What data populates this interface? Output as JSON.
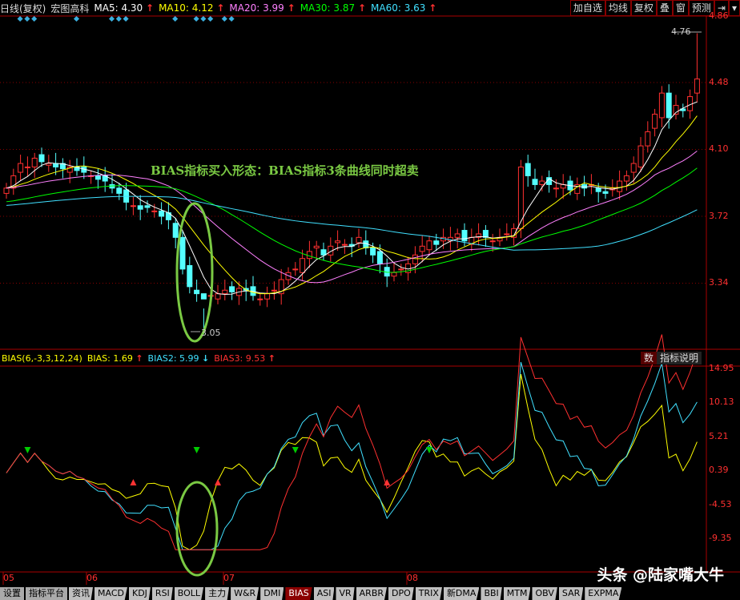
{
  "header": {
    "period": "日线(复权)",
    "stock": "宏图高科",
    "ma": [
      {
        "label": "MA5: 4.30",
        "color": "#ffffff"
      },
      {
        "label": "MA10: 4.12",
        "color": "#ffff00"
      },
      {
        "label": "MA20: 3.99",
        "color": "#ff80ff"
      },
      {
        "label": "MA30: 3.87",
        "color": "#00ff00"
      },
      {
        "label": "MA60: 3.63",
        "color": "#40e0ff"
      }
    ],
    "arrow_up": "↑",
    "arrow_down": "↓",
    "buttons": [
      "加自选",
      "均线",
      "复权",
      "叠",
      "窗",
      "预测",
      "⇥",
      "▾"
    ]
  },
  "price_axis": [
    "4.86",
    "4.48",
    "4.10",
    "3.72",
    "3.34"
  ],
  "price_marks": {
    "high": "4.76",
    "low": "3.05"
  },
  "annotation": "BIAS指标买入形态：BIAS指标3条曲线同时超卖",
  "indicator": {
    "title": "BIAS(6,-3,3,12,24)",
    "bias1": "BIAS: 1.69",
    "bias2": "BIAS2: 5.99",
    "bias3": "BIAS3: 9.53",
    "buttons": [
      "数",
      "指标说明"
    ],
    "axis": [
      "14.95",
      "10.13",
      "5.21",
      "0.39",
      "-4.53",
      "-9.35"
    ]
  },
  "dates": [
    "05",
    "06",
    "07",
    "08"
  ],
  "watermark": "头条 @陆家嘴大牛",
  "tabs": [
    "设置",
    "指标平台",
    "资讯",
    "MACD",
    "KDJ",
    "RSI",
    "BOLL",
    "主力",
    "W&R",
    "DMI",
    "BIAS",
    "ASI",
    "VR",
    "ARBR",
    "DPO",
    "TRIX",
    "新DMA",
    "BBI",
    "MTM",
    "OBV",
    "SAR",
    "EXPMA"
  ],
  "active_tab": "BIAS",
  "chart_data": {
    "type": "candlestick",
    "ylim": [
      3.0,
      4.86
    ],
    "bias_ylim": [
      -12,
      17
    ],
    "closes": [
      3.88,
      3.95,
      4.02,
      4.0,
      4.05,
      4.03,
      4.02,
      4.0,
      3.99,
      4.0,
      3.98,
      3.97,
      3.95,
      3.93,
      3.92,
      3.88,
      3.85,
      3.8,
      3.78,
      3.76,
      3.77,
      3.75,
      3.72,
      3.7,
      3.6,
      3.42,
      3.32,
      3.28,
      3.25,
      3.27,
      3.28,
      3.3,
      3.29,
      3.31,
      3.3,
      3.27,
      3.25,
      3.28,
      3.3,
      3.36,
      3.4,
      3.42,
      3.48,
      3.52,
      3.55,
      3.5,
      3.55,
      3.58,
      3.56,
      3.55,
      3.6,
      3.54,
      3.5,
      3.45,
      3.38,
      3.4,
      3.42,
      3.45,
      3.5,
      3.55,
      3.58,
      3.56,
      3.6,
      3.6,
      3.62,
      3.58,
      3.6,
      3.62,
      3.6,
      3.58,
      3.6,
      3.62,
      3.65,
      4.0,
      3.95,
      3.9,
      3.92,
      3.9,
      3.88,
      3.9,
      3.87,
      3.9,
      3.88,
      3.9,
      3.86,
      3.85,
      3.88,
      3.92,
      3.95,
      4.02,
      4.12,
      4.2,
      4.3,
      4.42,
      4.28,
      4.35,
      4.32,
      4.4,
      4.5
    ],
    "signal_diamonds": [
      2,
      3,
      4,
      10,
      15,
      16,
      17,
      24,
      27,
      28,
      29,
      31,
      32
    ]
  }
}
